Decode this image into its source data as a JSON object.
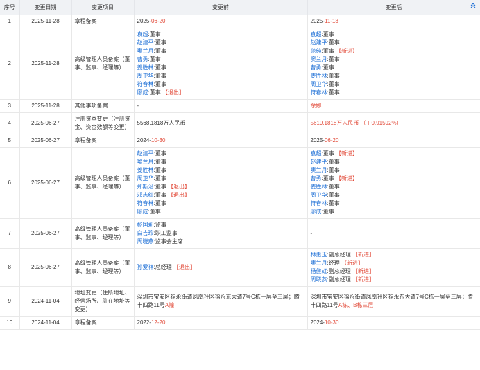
{
  "headers": {
    "index": "序号",
    "date": "变更日期",
    "item": "变更项目",
    "before": "变更前",
    "after": "变更后"
  },
  "rows": [
    {
      "index": "1",
      "date": "2025-11-28",
      "item": "章程备案",
      "before": [
        {
          "parts": [
            {
              "t": "2025-",
              "c": ""
            },
            {
              "t": "06-20",
              "c": "red"
            }
          ]
        }
      ],
      "after": [
        {
          "parts": [
            {
              "t": "2025-",
              "c": ""
            },
            {
              "t": "11-13",
              "c": "red"
            }
          ]
        }
      ]
    },
    {
      "index": "2",
      "date": "2025-11-28",
      "item": "高级管理人员备案（董事、监事、经理等）",
      "before": [
        {
          "parts": [
            {
              "t": "袁超",
              "c": "blue"
            },
            {
              "t": ":董事",
              "c": ""
            }
          ]
        },
        {
          "parts": [
            {
              "t": "赵建平",
              "c": "blue"
            },
            {
              "t": ":董事",
              "c": ""
            }
          ]
        },
        {
          "parts": [
            {
              "t": "窦兰月",
              "c": "blue"
            },
            {
              "t": ":董事",
              "c": ""
            }
          ]
        },
        {
          "parts": [
            {
              "t": "曹勇",
              "c": "blue"
            },
            {
              "t": ":董事",
              "c": ""
            }
          ]
        },
        {
          "parts": [
            {
              "t": "姜胜林",
              "c": "blue"
            },
            {
              "t": ":董事",
              "c": ""
            }
          ]
        },
        {
          "parts": [
            {
              "t": "周卫华",
              "c": "blue"
            },
            {
              "t": ":董事",
              "c": ""
            }
          ]
        },
        {
          "parts": [
            {
              "t": "符春林",
              "c": "blue"
            },
            {
              "t": ":董事",
              "c": ""
            }
          ]
        },
        {
          "parts": [
            {
              "t": "廖成",
              "c": "blue"
            },
            {
              "t": ":董事 ",
              "c": ""
            },
            {
              "t": "【退出】",
              "c": "red"
            }
          ]
        }
      ],
      "after": [
        {
          "parts": [
            {
              "t": "袁超",
              "c": "blue"
            },
            {
              "t": ":董事",
              "c": ""
            }
          ]
        },
        {
          "parts": [
            {
              "t": "赵建平",
              "c": "blue"
            },
            {
              "t": ":董事",
              "c": ""
            }
          ]
        },
        {
          "parts": [
            {
              "t": "范纯",
              "c": "blue"
            },
            {
              "t": ":董事 ",
              "c": ""
            },
            {
              "t": "【新进】",
              "c": "red"
            }
          ]
        },
        {
          "parts": [
            {
              "t": "窦兰月",
              "c": "blue"
            },
            {
              "t": ":董事",
              "c": ""
            }
          ]
        },
        {
          "parts": [
            {
              "t": "曹勇",
              "c": "blue"
            },
            {
              "t": ":董事",
              "c": ""
            }
          ]
        },
        {
          "parts": [
            {
              "t": "姜胜林",
              "c": "blue"
            },
            {
              "t": ":董事",
              "c": ""
            }
          ]
        },
        {
          "parts": [
            {
              "t": "周卫华",
              "c": "blue"
            },
            {
              "t": ":董事",
              "c": ""
            }
          ]
        },
        {
          "parts": [
            {
              "t": "符春林",
              "c": "blue"
            },
            {
              "t": ":董事",
              "c": ""
            }
          ]
        }
      ]
    },
    {
      "index": "3",
      "date": "2025-11-28",
      "item": "其他事项备案",
      "before": [
        {
          "parts": [
            {
              "t": "-",
              "c": ""
            }
          ]
        }
      ],
      "after": [
        {
          "parts": [
            {
              "t": "余娜",
              "c": "red"
            }
          ]
        }
      ]
    },
    {
      "index": "4",
      "date": "2025-06-27",
      "item": "注册资本变更（注册资金、资金数额等变更）",
      "before": [
        {
          "parts": [
            {
              "t": "5568.1818万人民币",
              "c": ""
            }
          ]
        }
      ],
      "after": [
        {
          "parts": [
            {
              "t": "5619.1818万人民币 （＋0.91592%）",
              "c": "red"
            }
          ]
        }
      ]
    },
    {
      "index": "5",
      "date": "2025-06-27",
      "item": "章程备案",
      "before": [
        {
          "parts": [
            {
              "t": "2024-",
              "c": ""
            },
            {
              "t": "10-30",
              "c": "red"
            }
          ]
        }
      ],
      "after": [
        {
          "parts": [
            {
              "t": "2025-",
              "c": ""
            },
            {
              "t": "06-20",
              "c": "red"
            }
          ]
        }
      ]
    },
    {
      "index": "6",
      "date": "2025-06-27",
      "item": "高级管理人员备案（董事、监事、经理等）",
      "before": [
        {
          "parts": [
            {
              "t": "赵建平",
              "c": "blue"
            },
            {
              "t": ":董事",
              "c": ""
            }
          ]
        },
        {
          "parts": [
            {
              "t": "窦兰月",
              "c": "blue"
            },
            {
              "t": ":董事",
              "c": ""
            }
          ]
        },
        {
          "parts": [
            {
              "t": "姜胜林",
              "c": "blue"
            },
            {
              "t": ":董事",
              "c": ""
            }
          ]
        },
        {
          "parts": [
            {
              "t": "周卫华",
              "c": "blue"
            },
            {
              "t": ":董事",
              "c": ""
            }
          ]
        },
        {
          "parts": [
            {
              "t": "郑斯治",
              "c": "blue"
            },
            {
              "t": ":董事 ",
              "c": ""
            },
            {
              "t": "【退出】",
              "c": "red"
            }
          ]
        },
        {
          "parts": [
            {
              "t": "邓志红",
              "c": "blue"
            },
            {
              "t": ":董事 ",
              "c": ""
            },
            {
              "t": "【退出】",
              "c": "red"
            }
          ]
        },
        {
          "parts": [
            {
              "t": "符春林",
              "c": "blue"
            },
            {
              "t": ":董事",
              "c": ""
            }
          ]
        },
        {
          "parts": [
            {
              "t": "廖成",
              "c": "blue"
            },
            {
              "t": ":董事",
              "c": ""
            }
          ]
        }
      ],
      "after": [
        {
          "parts": [
            {
              "t": "袁超",
              "c": "blue"
            },
            {
              "t": ":董事 ",
              "c": ""
            },
            {
              "t": "【新进】",
              "c": "red"
            }
          ]
        },
        {
          "parts": [
            {
              "t": "赵建平",
              "c": "blue"
            },
            {
              "t": ":董事",
              "c": ""
            }
          ]
        },
        {
          "parts": [
            {
              "t": "窦兰月",
              "c": "blue"
            },
            {
              "t": ":董事",
              "c": ""
            }
          ]
        },
        {
          "parts": [
            {
              "t": "曹勇",
              "c": "blue"
            },
            {
              "t": ":董事 ",
              "c": ""
            },
            {
              "t": "【新进】",
              "c": "red"
            }
          ]
        },
        {
          "parts": [
            {
              "t": "姜胜林",
              "c": "blue"
            },
            {
              "t": ":董事",
              "c": ""
            }
          ]
        },
        {
          "parts": [
            {
              "t": "周卫华",
              "c": "blue"
            },
            {
              "t": ":董事",
              "c": ""
            }
          ]
        },
        {
          "parts": [
            {
              "t": "符春林",
              "c": "blue"
            },
            {
              "t": ":董事",
              "c": ""
            }
          ]
        },
        {
          "parts": [
            {
              "t": "廖成",
              "c": "blue"
            },
            {
              "t": ":董事",
              "c": ""
            }
          ]
        }
      ]
    },
    {
      "index": "7",
      "date": "2025-06-27",
      "item": "高级管理人员备案（董事、监事、经理等）",
      "before": [
        {
          "parts": [
            {
              "t": "杨国莉",
              "c": "blue"
            },
            {
              "t": ":监事",
              "c": ""
            }
          ]
        },
        {
          "parts": [
            {
              "t": "白吉珍",
              "c": "blue"
            },
            {
              "t": ":职工监事",
              "c": ""
            }
          ]
        },
        {
          "parts": [
            {
              "t": "周晓燕",
              "c": "blue"
            },
            {
              "t": ":监事会主席",
              "c": ""
            }
          ]
        }
      ],
      "after": [
        {
          "parts": [
            {
              "t": "-",
              "c": ""
            }
          ]
        }
      ]
    },
    {
      "index": "8",
      "date": "2025-06-27",
      "item": "高级管理人员备案（董事、监事、经理等）",
      "before": [
        {
          "parts": [
            {
              "t": "孙爱祥",
              "c": "blue"
            },
            {
              "t": ":总经理 ",
              "c": ""
            },
            {
              "t": "【退出】",
              "c": "red"
            }
          ]
        }
      ],
      "after": [
        {
          "parts": [
            {
              "t": "林惠玉",
              "c": "blue"
            },
            {
              "t": ":副总经理 ",
              "c": ""
            },
            {
              "t": "【新进】",
              "c": "red"
            }
          ]
        },
        {
          "parts": [
            {
              "t": "窦兰月",
              "c": "blue"
            },
            {
              "t": ":经理 ",
              "c": ""
            },
            {
              "t": "【新进】",
              "c": "red"
            }
          ]
        },
        {
          "parts": [
            {
              "t": "杨健虹",
              "c": "blue"
            },
            {
              "t": ":副总经理 ",
              "c": ""
            },
            {
              "t": "【新进】",
              "c": "red"
            }
          ]
        },
        {
          "parts": [
            {
              "t": "周晓燕",
              "c": "blue"
            },
            {
              "t": ":副总经理 ",
              "c": ""
            },
            {
              "t": "【新进】",
              "c": "red"
            }
          ]
        }
      ]
    },
    {
      "index": "9",
      "date": "2024-11-04",
      "item": "地址变更（住所地址、经营场所、驻在地址等变更）",
      "before": [
        {
          "parts": [
            {
              "t": "深圳市宝安区福永街道凤凰社区福永东大道7号C栋一层至三层；腾丰四路11号",
              "c": ""
            },
            {
              "t": "A幢",
              "c": "red"
            }
          ]
        }
      ],
      "after": [
        {
          "parts": [
            {
              "t": "深圳市宝安区福永街道凤凰社区福永东大道7号C栋一层至三层；腾丰四路11号",
              "c": ""
            },
            {
              "t": "A栋、B栋三层",
              "c": "red"
            }
          ]
        }
      ]
    },
    {
      "index": "10",
      "date": "2024-11-04",
      "item": "章程备案",
      "before": [
        {
          "parts": [
            {
              "t": "2022-",
              "c": ""
            },
            {
              "t": "12-20",
              "c": "red"
            }
          ]
        }
      ],
      "after": [
        {
          "parts": [
            {
              "t": "2024-",
              "c": ""
            },
            {
              "t": "10-30",
              "c": "red"
            }
          ]
        }
      ]
    }
  ],
  "colors": {
    "link": "#1d6fd6",
    "highlight": "#e24c3b",
    "header_bg": "#f0f2f5"
  },
  "icons": {
    "collapse": "chevron-up-icon"
  }
}
